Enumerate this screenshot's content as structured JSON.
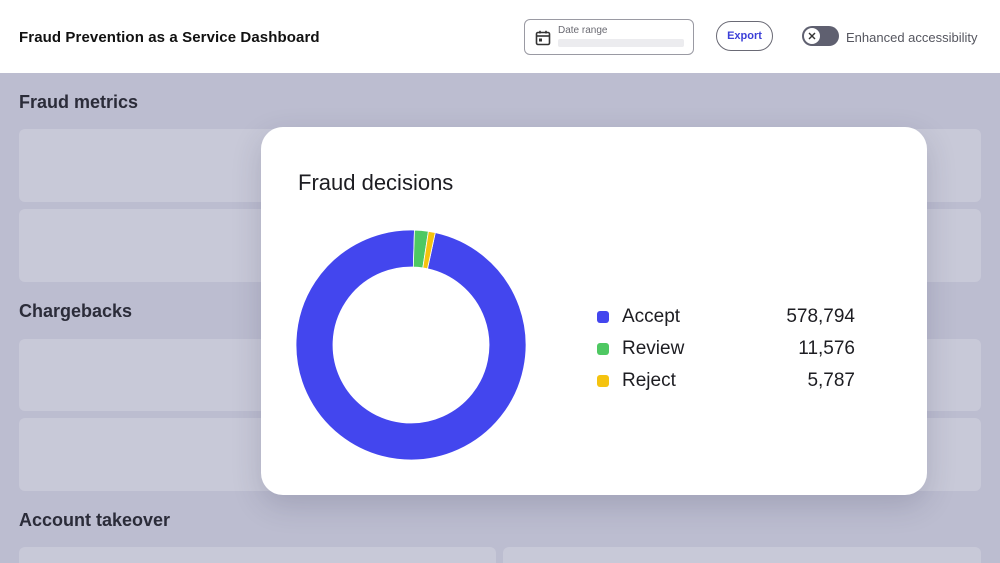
{
  "header": {
    "title": "Fraud Prevention as a Service Dashboard",
    "date_range_label": "Date range",
    "export_label": "Export",
    "accessibility_label": "Enhanced accessibility"
  },
  "sections": {
    "fraud_metrics": "Fraud metrics",
    "chargebacks": "Chargebacks",
    "account_takeover": "Account takeover"
  },
  "card": {
    "title": "Fraud decisions",
    "legend": [
      {
        "name": "Accept",
        "value": "578,794",
        "color": "#4346ee"
      },
      {
        "name": "Review",
        "value": "11,576",
        "color": "#4ec862"
      },
      {
        "name": "Reject",
        "value": "5,787",
        "color": "#f5c30f"
      }
    ]
  },
  "chart_data": {
    "type": "pie",
    "categories": [
      "Accept",
      "Review",
      "Reject"
    ],
    "values": [
      578794,
      11576,
      5787
    ],
    "colors": [
      "#4346ee",
      "#4ec862",
      "#f5c30f"
    ],
    "donut": true,
    "legend_placement": "right",
    "title": "Fraud decisions"
  }
}
